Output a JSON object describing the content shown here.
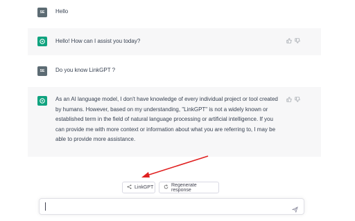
{
  "messages": [
    {
      "role": "user",
      "avatar": "SE",
      "text": "Hello"
    },
    {
      "role": "assistant",
      "text": "Hello! How can I assist you today?"
    },
    {
      "role": "user",
      "avatar": "SE",
      "text": "Do you know LinkGPT ?"
    },
    {
      "role": "assistant",
      "lines": [
        "As an AI language model, I don't have knowledge of every individual project or tool created",
        "by humans. However, based on my understanding, \"LinkGPT\" is not a widely known or",
        "established term in the field of natural language processing or artificial intelligence. If you",
        "can provide me with more context or information about what you are referring to, I may be",
        "able to provide more assistance."
      ]
    }
  ],
  "actions": {
    "linkgpt_label": "LinkGPT",
    "regenerate_label": "Regenerate response"
  },
  "composer": {
    "placeholder": ""
  },
  "colors": {
    "assistant_bg": "#f7f7f8",
    "bot_avatar": "#10a37f",
    "user_avatar": "#5c6b73",
    "annotation_arrow": "#e02020"
  },
  "icons": {
    "bot": "openai-logo-icon",
    "thumbs_up": "thumbs-up-icon",
    "thumbs_down": "thumbs-down-icon",
    "share": "share-icon",
    "regenerate": "refresh-icon",
    "send": "paper-plane-icon"
  }
}
